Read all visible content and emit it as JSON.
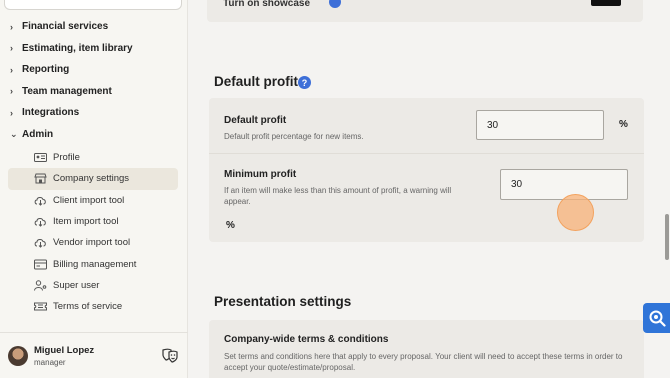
{
  "sidebar": {
    "nav": [
      {
        "label": "Financial services",
        "state": "collapsed"
      },
      {
        "label": "Estimating, item library",
        "state": "collapsed"
      },
      {
        "label": "Reporting",
        "state": "collapsed"
      },
      {
        "label": "Team management",
        "state": "collapsed"
      },
      {
        "label": "Integrations",
        "state": "collapsed"
      },
      {
        "label": "Admin",
        "state": "expanded"
      }
    ],
    "admin_items": [
      {
        "label": "Profile",
        "icon": "id-card-icon"
      },
      {
        "label": "Company settings",
        "icon": "store-icon",
        "active": true
      },
      {
        "label": "Client import tool",
        "icon": "cloud-download-icon"
      },
      {
        "label": "Item import tool",
        "icon": "cloud-download-icon"
      },
      {
        "label": "Vendor import tool",
        "icon": "cloud-download-icon"
      },
      {
        "label": "Billing management",
        "icon": "billing-icon"
      },
      {
        "label": "Super user",
        "icon": "user-key-icon"
      },
      {
        "label": "Terms of service",
        "icon": "ticket-icon"
      }
    ],
    "user": {
      "name": "Miguel Lopez",
      "role": "manager"
    }
  },
  "main": {
    "top_row_label": "Turn on showcase",
    "default_profit": {
      "section_title": "Default profit",
      "default_label": "Default profit",
      "default_desc": "Default profit percentage for new items.",
      "default_value": "30",
      "default_unit": "%",
      "minimum_label": "Minimum profit",
      "minimum_desc": "If an item will make less than this amount of profit, a warning will appear.",
      "minimum_value": "30",
      "minimum_unit": "%"
    },
    "presentation": {
      "section_title": "Presentation settings",
      "terms_label": "Company-wide terms & conditions",
      "terms_desc": "Set terms and conditions here that apply to every proposal. Your client will need to accept these terms in order to accept your quote/estimate/proposal."
    }
  },
  "colors": {
    "accent": "#3d6fd8",
    "float_button": "#2f74d8",
    "active_nav_bg": "#ebe7dd",
    "cursor": "#f3a25e"
  }
}
